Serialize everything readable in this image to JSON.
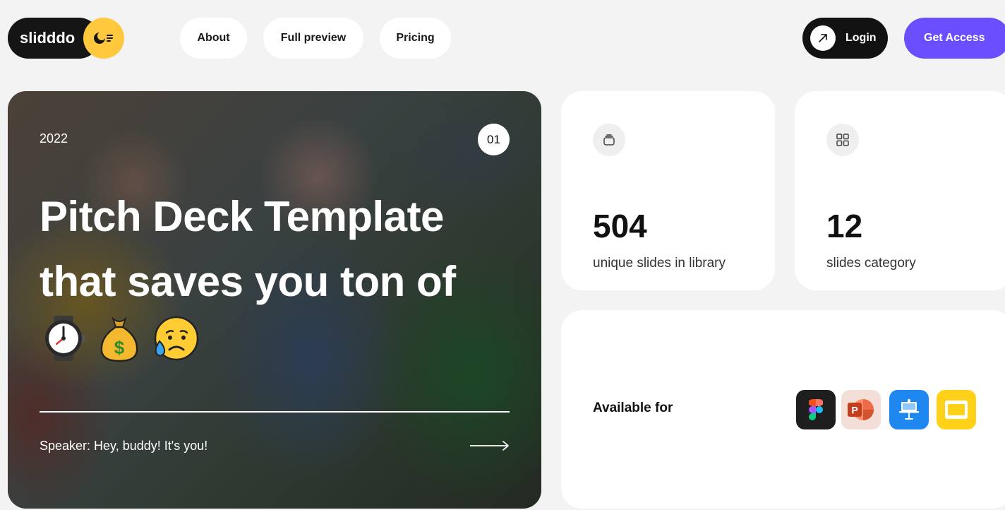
{
  "nav": {
    "logo_text": "slidddo",
    "links": [
      {
        "label": "About"
      },
      {
        "label": "Full preview"
      },
      {
        "label": "Pricing"
      }
    ],
    "login_label": "Login",
    "access_label": "Get Access"
  },
  "hero": {
    "year": "2022",
    "slide_number": "01",
    "title_line1": "Pitch Deck Template",
    "title_line2": "that saves you ton of",
    "emoji_icons": [
      "watch-emoji",
      "money-bag-emoji",
      "sad-sweat-emoji"
    ],
    "speaker": "Speaker: Hey, buddy! It's you!"
  },
  "stats": [
    {
      "value": "504",
      "label": "unique slides in library",
      "icon": "stack-icon"
    },
    {
      "value": "12",
      "label": "slides category",
      "icon": "grid-icon"
    }
  ],
  "available": {
    "label": "Available for",
    "apps": [
      "figma-icon",
      "powerpoint-icon",
      "keynote-icon",
      "google-slides-icon"
    ]
  },
  "colors": {
    "background": "#f3f3f3",
    "accent": "#6b4eff",
    "logo_yellow": "#ffc83d",
    "dark": "#121212"
  }
}
